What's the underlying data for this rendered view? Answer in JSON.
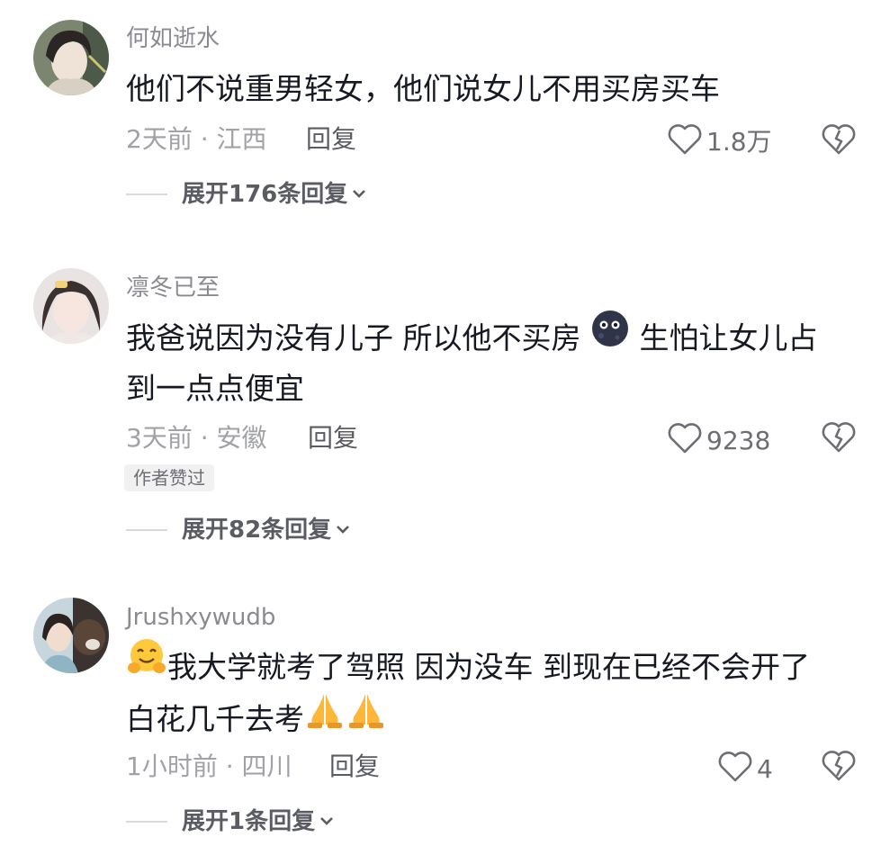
{
  "comments": [
    {
      "username": "何如逝水",
      "lines": [
        "他们不说重男轻女，他们说女儿不用买房买车"
      ],
      "time_location": "2天前 · 江西",
      "reply_label": "回复",
      "likes": "1.8万",
      "expand_label": "展开176条回复"
    },
    {
      "username": "凛冬已至",
      "line1_a": "我爸说因为没有儿子 所以他不买房 ",
      "emoji_1": "moon-face-emoji",
      "line1_b": " 生怕让女儿占",
      "line2": "到一点点便宜",
      "time_location": "3天前 · 安徽",
      "reply_label": "回复",
      "likes": "9238",
      "badge": "作者赞过",
      "expand_label": "展开82条回复"
    },
    {
      "username": "Jrushxywudb",
      "emoji_1": "hugging-face-emoji",
      "line1": "我大学就考了驾照 因为没车 到现在已经不会开了",
      "line2": "白花几千去考",
      "emoji_2": "folded-hands-emoji",
      "time_location": "1小时前 · 四川",
      "reply_label": "回复",
      "likes": "4",
      "expand_label": "展开1条回复"
    }
  ],
  "icons": {
    "like": "heart-outline-icon",
    "dislike": "broken-heart-icon",
    "expand": "chevron-down-icon"
  },
  "colors": {
    "text": "#161823",
    "username": "#8a8b91",
    "meta": "#a1a2a7",
    "icon": "#6d6e74"
  }
}
